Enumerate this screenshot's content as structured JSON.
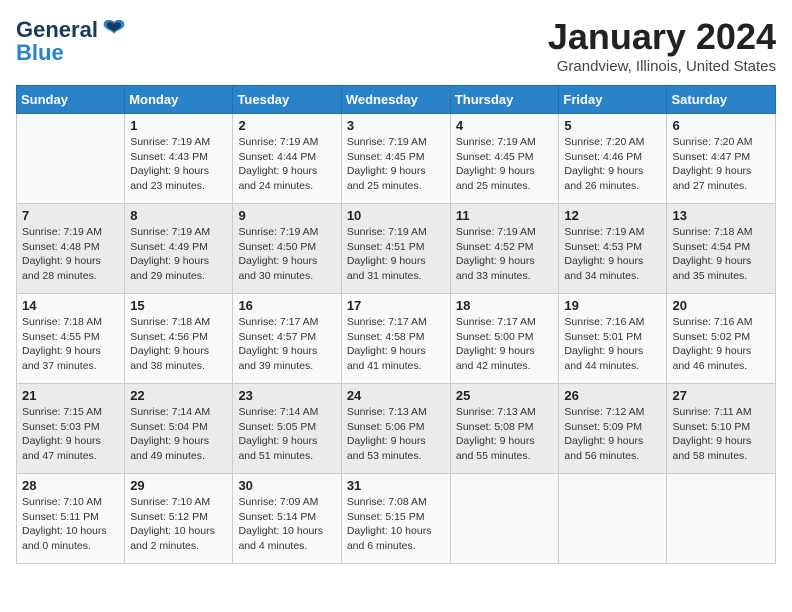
{
  "logo": {
    "general": "General",
    "blue": "Blue"
  },
  "title": "January 2024",
  "location": "Grandview, Illinois, United States",
  "days_of_week": [
    "Sunday",
    "Monday",
    "Tuesday",
    "Wednesday",
    "Thursday",
    "Friday",
    "Saturday"
  ],
  "weeks": [
    [
      {
        "day": "",
        "sunrise": "",
        "sunset": "",
        "daylight": ""
      },
      {
        "day": "1",
        "sunrise": "Sunrise: 7:19 AM",
        "sunset": "Sunset: 4:43 PM",
        "daylight": "Daylight: 9 hours and 23 minutes."
      },
      {
        "day": "2",
        "sunrise": "Sunrise: 7:19 AM",
        "sunset": "Sunset: 4:44 PM",
        "daylight": "Daylight: 9 hours and 24 minutes."
      },
      {
        "day": "3",
        "sunrise": "Sunrise: 7:19 AM",
        "sunset": "Sunset: 4:45 PM",
        "daylight": "Daylight: 9 hours and 25 minutes."
      },
      {
        "day": "4",
        "sunrise": "Sunrise: 7:19 AM",
        "sunset": "Sunset: 4:45 PM",
        "daylight": "Daylight: 9 hours and 25 minutes."
      },
      {
        "day": "5",
        "sunrise": "Sunrise: 7:20 AM",
        "sunset": "Sunset: 4:46 PM",
        "daylight": "Daylight: 9 hours and 26 minutes."
      },
      {
        "day": "6",
        "sunrise": "Sunrise: 7:20 AM",
        "sunset": "Sunset: 4:47 PM",
        "daylight": "Daylight: 9 hours and 27 minutes."
      }
    ],
    [
      {
        "day": "7",
        "sunrise": "Sunrise: 7:19 AM",
        "sunset": "Sunset: 4:48 PM",
        "daylight": "Daylight: 9 hours and 28 minutes."
      },
      {
        "day": "8",
        "sunrise": "Sunrise: 7:19 AM",
        "sunset": "Sunset: 4:49 PM",
        "daylight": "Daylight: 9 hours and 29 minutes."
      },
      {
        "day": "9",
        "sunrise": "Sunrise: 7:19 AM",
        "sunset": "Sunset: 4:50 PM",
        "daylight": "Daylight: 9 hours and 30 minutes."
      },
      {
        "day": "10",
        "sunrise": "Sunrise: 7:19 AM",
        "sunset": "Sunset: 4:51 PM",
        "daylight": "Daylight: 9 hours and 31 minutes."
      },
      {
        "day": "11",
        "sunrise": "Sunrise: 7:19 AM",
        "sunset": "Sunset: 4:52 PM",
        "daylight": "Daylight: 9 hours and 33 minutes."
      },
      {
        "day": "12",
        "sunrise": "Sunrise: 7:19 AM",
        "sunset": "Sunset: 4:53 PM",
        "daylight": "Daylight: 9 hours and 34 minutes."
      },
      {
        "day": "13",
        "sunrise": "Sunrise: 7:18 AM",
        "sunset": "Sunset: 4:54 PM",
        "daylight": "Daylight: 9 hours and 35 minutes."
      }
    ],
    [
      {
        "day": "14",
        "sunrise": "Sunrise: 7:18 AM",
        "sunset": "Sunset: 4:55 PM",
        "daylight": "Daylight: 9 hours and 37 minutes."
      },
      {
        "day": "15",
        "sunrise": "Sunrise: 7:18 AM",
        "sunset": "Sunset: 4:56 PM",
        "daylight": "Daylight: 9 hours and 38 minutes."
      },
      {
        "day": "16",
        "sunrise": "Sunrise: 7:17 AM",
        "sunset": "Sunset: 4:57 PM",
        "daylight": "Daylight: 9 hours and 39 minutes."
      },
      {
        "day": "17",
        "sunrise": "Sunrise: 7:17 AM",
        "sunset": "Sunset: 4:58 PM",
        "daylight": "Daylight: 9 hours and 41 minutes."
      },
      {
        "day": "18",
        "sunrise": "Sunrise: 7:17 AM",
        "sunset": "Sunset: 5:00 PM",
        "daylight": "Daylight: 9 hours and 42 minutes."
      },
      {
        "day": "19",
        "sunrise": "Sunrise: 7:16 AM",
        "sunset": "Sunset: 5:01 PM",
        "daylight": "Daylight: 9 hours and 44 minutes."
      },
      {
        "day": "20",
        "sunrise": "Sunrise: 7:16 AM",
        "sunset": "Sunset: 5:02 PM",
        "daylight": "Daylight: 9 hours and 46 minutes."
      }
    ],
    [
      {
        "day": "21",
        "sunrise": "Sunrise: 7:15 AM",
        "sunset": "Sunset: 5:03 PM",
        "daylight": "Daylight: 9 hours and 47 minutes."
      },
      {
        "day": "22",
        "sunrise": "Sunrise: 7:14 AM",
        "sunset": "Sunset: 5:04 PM",
        "daylight": "Daylight: 9 hours and 49 minutes."
      },
      {
        "day": "23",
        "sunrise": "Sunrise: 7:14 AM",
        "sunset": "Sunset: 5:05 PM",
        "daylight": "Daylight: 9 hours and 51 minutes."
      },
      {
        "day": "24",
        "sunrise": "Sunrise: 7:13 AM",
        "sunset": "Sunset: 5:06 PM",
        "daylight": "Daylight: 9 hours and 53 minutes."
      },
      {
        "day": "25",
        "sunrise": "Sunrise: 7:13 AM",
        "sunset": "Sunset: 5:08 PM",
        "daylight": "Daylight: 9 hours and 55 minutes."
      },
      {
        "day": "26",
        "sunrise": "Sunrise: 7:12 AM",
        "sunset": "Sunset: 5:09 PM",
        "daylight": "Daylight: 9 hours and 56 minutes."
      },
      {
        "day": "27",
        "sunrise": "Sunrise: 7:11 AM",
        "sunset": "Sunset: 5:10 PM",
        "daylight": "Daylight: 9 hours and 58 minutes."
      }
    ],
    [
      {
        "day": "28",
        "sunrise": "Sunrise: 7:10 AM",
        "sunset": "Sunset: 5:11 PM",
        "daylight": "Daylight: 10 hours and 0 minutes."
      },
      {
        "day": "29",
        "sunrise": "Sunrise: 7:10 AM",
        "sunset": "Sunset: 5:12 PM",
        "daylight": "Daylight: 10 hours and 2 minutes."
      },
      {
        "day": "30",
        "sunrise": "Sunrise: 7:09 AM",
        "sunset": "Sunset: 5:14 PM",
        "daylight": "Daylight: 10 hours and 4 minutes."
      },
      {
        "day": "31",
        "sunrise": "Sunrise: 7:08 AM",
        "sunset": "Sunset: 5:15 PM",
        "daylight": "Daylight: 10 hours and 6 minutes."
      },
      {
        "day": "",
        "sunrise": "",
        "sunset": "",
        "daylight": ""
      },
      {
        "day": "",
        "sunrise": "",
        "sunset": "",
        "daylight": ""
      },
      {
        "day": "",
        "sunrise": "",
        "sunset": "",
        "daylight": ""
      }
    ]
  ]
}
